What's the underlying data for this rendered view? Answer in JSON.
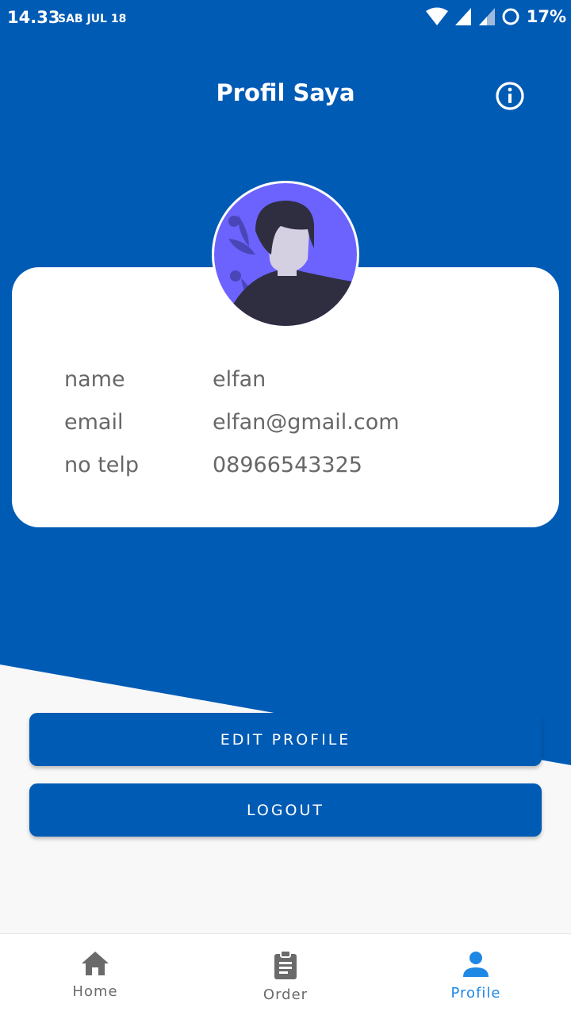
{
  "status_bar": {
    "time": "14.33",
    "date": "SAB JUL 18",
    "battery": "17%"
  },
  "header": {
    "title": "Profil Saya",
    "info_icon": "info-icon"
  },
  "profile": {
    "avatar_icon": "user-avatar-illustration",
    "fields": [
      {
        "label": "name",
        "value": "elfan"
      },
      {
        "label": "email",
        "value": "elfan@gmail.com"
      },
      {
        "label": "no telp",
        "value": "08966543325"
      }
    ]
  },
  "actions": {
    "edit_label": "EDIT PROFILE",
    "logout_label": "LOGOUT"
  },
  "bottom_nav": {
    "items": [
      {
        "label": "Home",
        "icon": "home-icon",
        "active": false
      },
      {
        "label": "Order",
        "icon": "clipboard-icon",
        "active": false
      },
      {
        "label": "Profile",
        "icon": "person-icon",
        "active": true
      }
    ]
  },
  "colors": {
    "primary": "#005bb5",
    "background": "#f8f8f8",
    "active_nav": "#1e88e5",
    "inactive_nav": "#6a6a6a",
    "avatar_bg": "#6c63ff"
  }
}
